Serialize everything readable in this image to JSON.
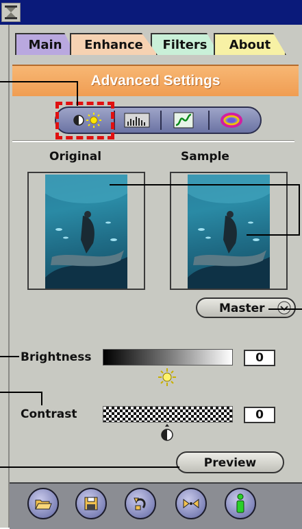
{
  "tabs": [
    {
      "label": "Main"
    },
    {
      "label": "Enhance"
    },
    {
      "label": "Filters"
    },
    {
      "label": "About"
    }
  ],
  "header": {
    "title": "Advanced Settings"
  },
  "toolbar": {
    "icons": [
      "brightness-contrast-icon",
      "histogram-icon",
      "curve-icon",
      "color-wheel-icon"
    ]
  },
  "previews": {
    "original_label": "Original",
    "sample_label": "Sample"
  },
  "channel": {
    "selected": "Master"
  },
  "brightness": {
    "label": "Brightness",
    "value": "0",
    "level": 0.5
  },
  "contrast": {
    "label": "Contrast",
    "value": "0",
    "level": 0.5
  },
  "preview_button": {
    "label": "Preview"
  },
  "bottom_buttons": [
    "open-folder-icon",
    "save-icon",
    "undo-icon",
    "compare-icon",
    "info-icon"
  ],
  "colors": {
    "title_bar": "#0a1a7a",
    "header": "#f09d52",
    "highlight": "#e01010",
    "window": "#c8c9c2"
  }
}
